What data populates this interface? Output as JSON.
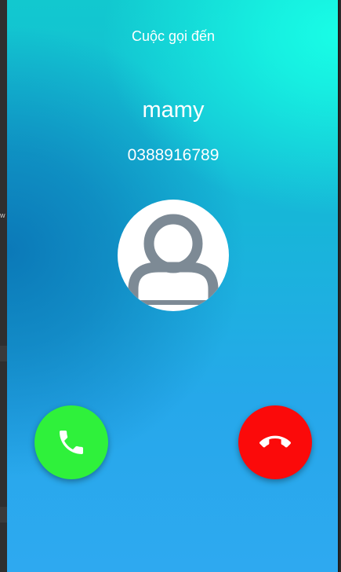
{
  "incoming_call": {
    "title": "Cuộc gọi đến",
    "caller_name": "mamy",
    "caller_number": "0388916789",
    "avatar_icon": "person-icon"
  },
  "actions": {
    "answer_icon": "phone-icon",
    "answer_color": "#2ff13b",
    "decline_icon": "hang-up-icon",
    "decline_color": "#fb0a0a"
  },
  "background_colors": {
    "top_right": "#18fde6",
    "middle_left": "#0b79b8",
    "bottom": "#2ea9f0"
  }
}
